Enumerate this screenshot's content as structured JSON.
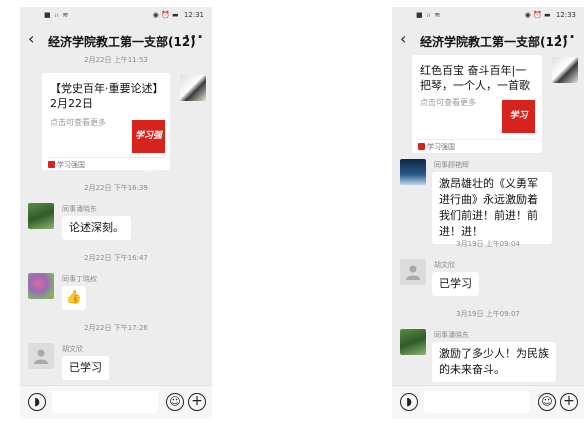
{
  "left": {
    "status": {
      "signal": "■ ᵢₗ ≋",
      "right_icons": "◉ ⏰ ▬",
      "time": "12:31"
    },
    "header": {
      "back": "‹",
      "title": "经济学院教工第一支部(12)",
      "more": "···"
    },
    "messages": {
      "ts1": "2月22日 上午11:53",
      "card": {
        "title": "【党史百年·重要论述】2月22日",
        "subtitle": "点击可查看更多",
        "thumb": "学习强国",
        "source": "学习强国"
      },
      "ts2": "2月22日 下午16:39",
      "m1": {
        "sender": "同事潘晓东",
        "text": "论述深刻。"
      },
      "ts3": "2月22日 下午16:47",
      "m2": {
        "sender": "同事丁晓权",
        "emoji": "👍"
      },
      "ts4": "2月22日 下午17:26",
      "m3": {
        "sender": "胡文欣",
        "text": "已学习"
      }
    },
    "input": {
      "voice": "◗",
      "emoji": "☺",
      "plus": "+"
    }
  },
  "right": {
    "status": {
      "signal": "■ ᵢₗ ≋",
      "right_icons": "◉ ⏰ ▬",
      "time": "12:33"
    },
    "header": {
      "back": "‹",
      "title": "经济学院教工第一支部(12)",
      "more": "···"
    },
    "messages": {
      "card": {
        "title": "红色百宝 奋斗百年|一把琴，一个人，一首歌",
        "subtitle": "点击可查看更多",
        "thumb": "学习",
        "source": "学习强国"
      },
      "m1": {
        "sender": "同事顾艳辉",
        "text": "激昂雄壮的《义勇军进行曲》永远激励着我们前进！前进！前进！进！"
      },
      "ts1": "3月19日 上午09:04",
      "m2": {
        "sender": "胡文欣",
        "text": "已学习"
      },
      "ts2": "3月19日 上午09:07",
      "m3": {
        "sender": "同事潘晓东",
        "text": "激励了多少人！为民族的未来奋斗。"
      }
    },
    "input": {
      "voice": "◗",
      "emoji": "☺",
      "plus": "+"
    }
  }
}
